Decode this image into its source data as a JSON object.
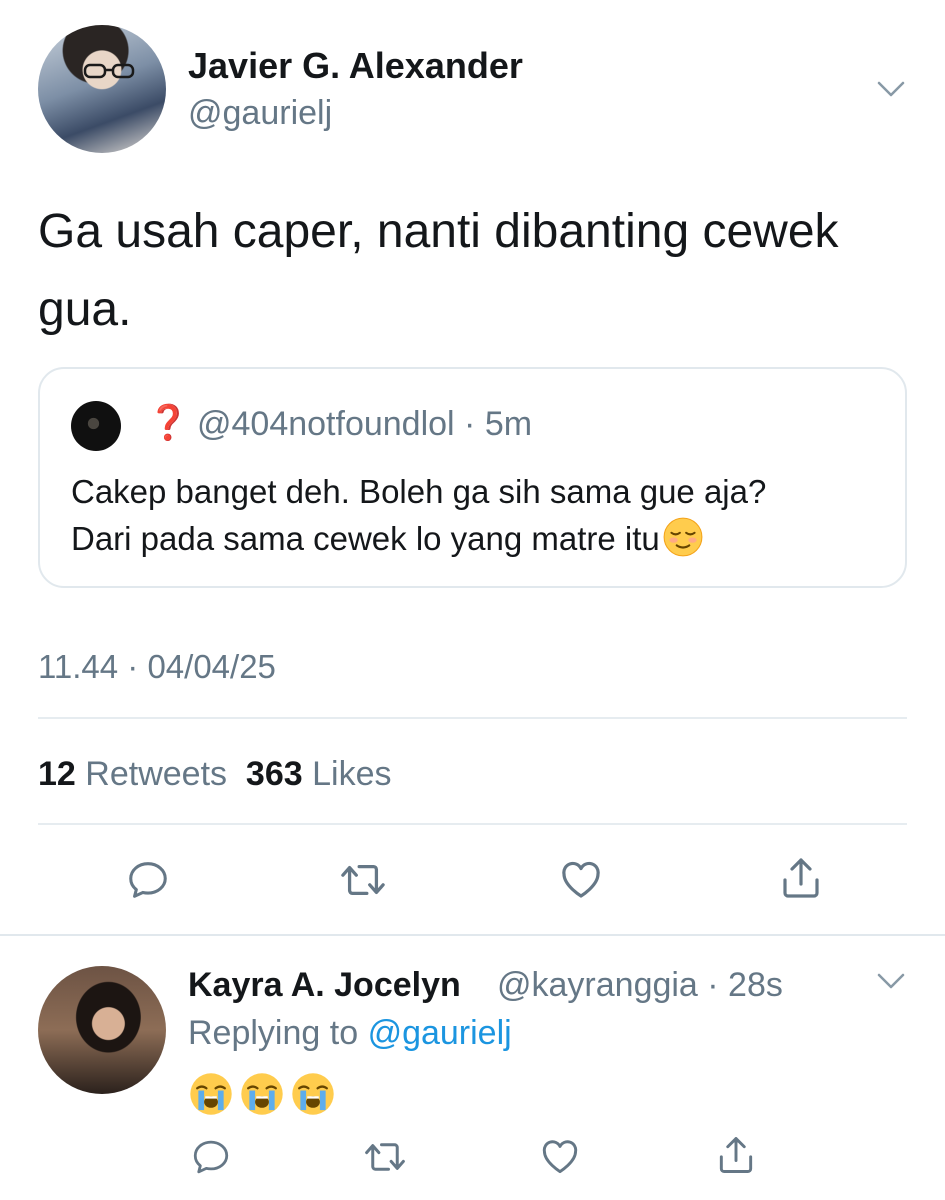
{
  "tweet": {
    "author_name": "Javier G. Alexander",
    "author_handle": "@gaurielj",
    "text": "Ga usah caper, nanti dibanting cewek\ngua.",
    "timestamp": "11.44 · 04/04/25",
    "retweets_count": "12",
    "retweets_label": "Retweets",
    "likes_count": "363",
    "likes_label": "Likes"
  },
  "quoted_tweet": {
    "icon": "❓",
    "handle_time": "@404notfoundlol · 5m",
    "text": "Cakep banget deh. Boleh ga sih sama gue aja?\nDari pada sama cewek lo yang matre itu",
    "trailing_emoji": "relieved-face-emoji"
  },
  "reply": {
    "author_name": "Kayra A. Jocelyn",
    "handle_time": "@kayranggia · 28s",
    "replying_to_prefix": "Replying to",
    "replying_to_mention": "@gaurielj",
    "emojis": [
      "loudly-crying-face-emoji",
      "loudly-crying-face-emoji",
      "loudly-crying-face-emoji"
    ]
  },
  "actions": [
    "reply-icon",
    "retweet-icon",
    "like-icon",
    "share-icon"
  ],
  "colors": {
    "text": "#14171a",
    "secondary": "#657786",
    "link": "#1b95e0",
    "divider": "#e6ecf0",
    "icon": "#657786"
  }
}
